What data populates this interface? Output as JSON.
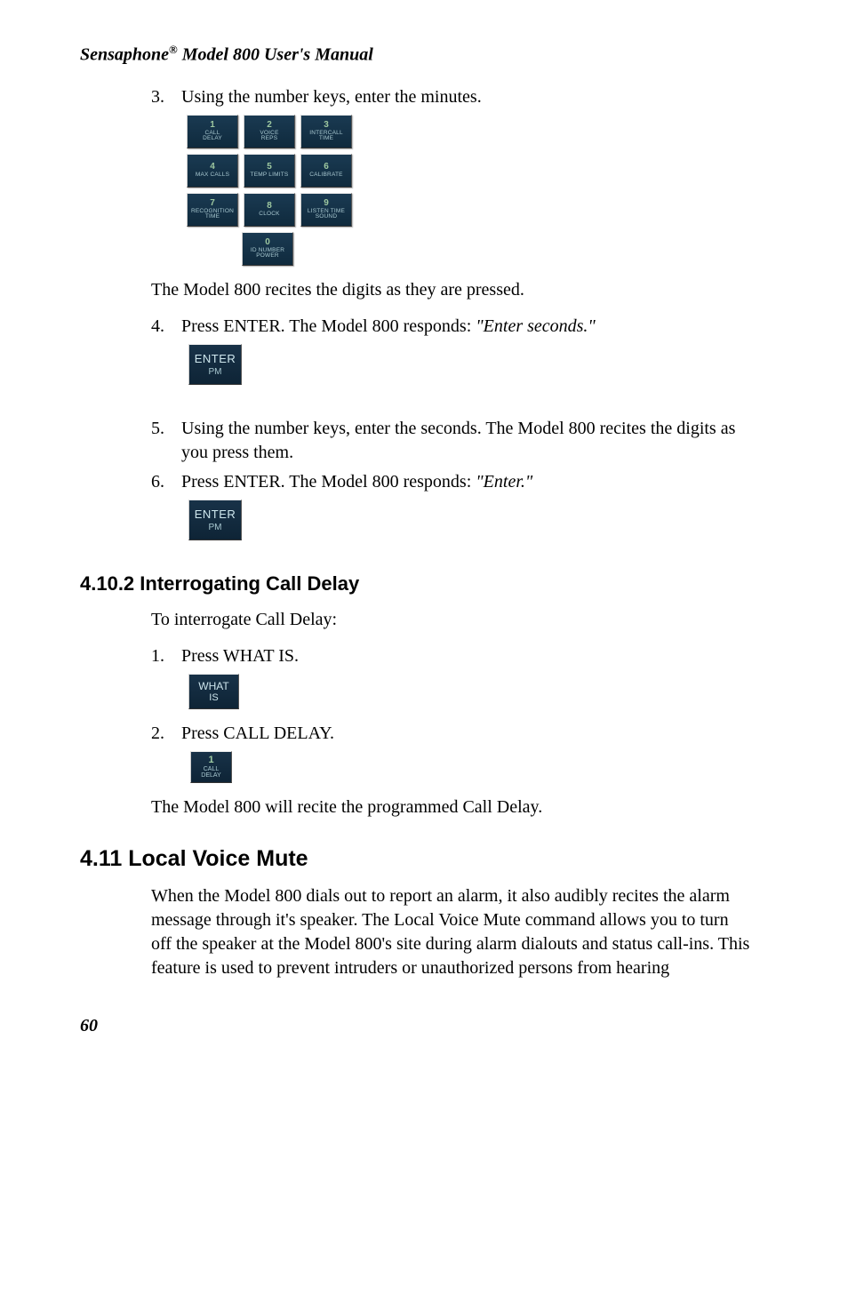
{
  "header": {
    "brand": "Sensaphone",
    "reg": "®",
    "model_desc": " Model 800 User's Manual"
  },
  "step3": {
    "num": "3.",
    "text": "Using the number keys, enter the minutes."
  },
  "keypad": [
    [
      {
        "num": "1",
        "label": "CALL\nDELAY"
      },
      {
        "num": "2",
        "label": "VOICE\nREPS"
      },
      {
        "num": "3",
        "label": "INTERCALL\nTIME"
      }
    ],
    [
      {
        "num": "4",
        "label": "MAX CALLS"
      },
      {
        "num": "5",
        "label": "TEMP LIMITS"
      },
      {
        "num": "6",
        "label": "CALIBRATE"
      }
    ],
    [
      {
        "num": "7",
        "label": "RECOGNITION\nTIME"
      },
      {
        "num": "8",
        "label": "CLOCK"
      },
      {
        "num": "9",
        "label": "LISTEN TIME\nSOUND"
      }
    ],
    [
      null,
      {
        "num": "0",
        "label": "ID NUMBER\nPOWER"
      },
      null
    ]
  ],
  "recite": "The Model 800 recites the digits as they are pressed.",
  "step4": {
    "num": "4.",
    "text_a": "Press ENTER. The Model 800 responds: ",
    "text_i": "\"Enter seconds.\""
  },
  "enter_key": {
    "line1": "ENTER",
    "line2": "PM"
  },
  "step5": {
    "num": "5.",
    "text": "Using the number keys, enter the seconds. The Model 800 recites the digits as you press them."
  },
  "step6": {
    "num": "6.",
    "text_a": "Press ENTER. The Model 800 responds: ",
    "text_i": "\"Enter.\""
  },
  "sec_4_10_2": {
    "heading": "4.10.2  Interrogating Call Delay",
    "intro": "To interrogate Call Delay:",
    "s1": {
      "num": "1.",
      "text": "Press WHAT IS."
    },
    "what_key": {
      "line1": "WHAT",
      "line2": "IS"
    },
    "s2": {
      "num": "2.",
      "text": "Press CALL DELAY."
    },
    "call_key": {
      "num": "1",
      "label": "CALL\nDELAY"
    },
    "outro": "The Model 800 will recite the programmed Call Delay."
  },
  "sec_4_11": {
    "heading": "4.11  Local Voice Mute",
    "body": "When the Model 800 dials out to report an alarm, it also audibly recites the alarm message through it's speaker. The Local Voice Mute command allows you to turn off the speaker at the Model 800's site during alarm dialouts and status call-ins.  This feature is used to prevent intruders or unauthorized persons from hearing"
  },
  "page_number": "60"
}
